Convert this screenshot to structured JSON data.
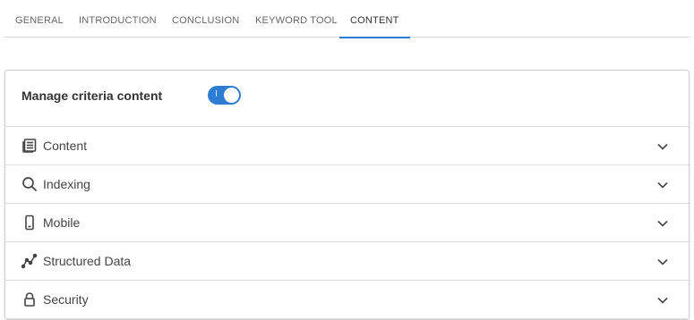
{
  "tabs": [
    {
      "label": "GENERAL"
    },
    {
      "label": "INTRODUCTION"
    },
    {
      "label": "CONCLUSION"
    },
    {
      "label": "KEYWORD TOOL"
    },
    {
      "label": "CONTENT",
      "active": true
    }
  ],
  "panel": {
    "title": "Manage criteria content",
    "toggle_on": true,
    "accent_color": "#2f7dd3",
    "sections": [
      {
        "label": "Content",
        "icon": "newspaper-icon"
      },
      {
        "label": "Indexing",
        "icon": "search-icon"
      },
      {
        "label": "Mobile",
        "icon": "mobile-phone-icon"
      },
      {
        "label": "Structured Data",
        "icon": "line-chart-icon"
      },
      {
        "label": "Security",
        "icon": "lock-icon"
      }
    ]
  }
}
